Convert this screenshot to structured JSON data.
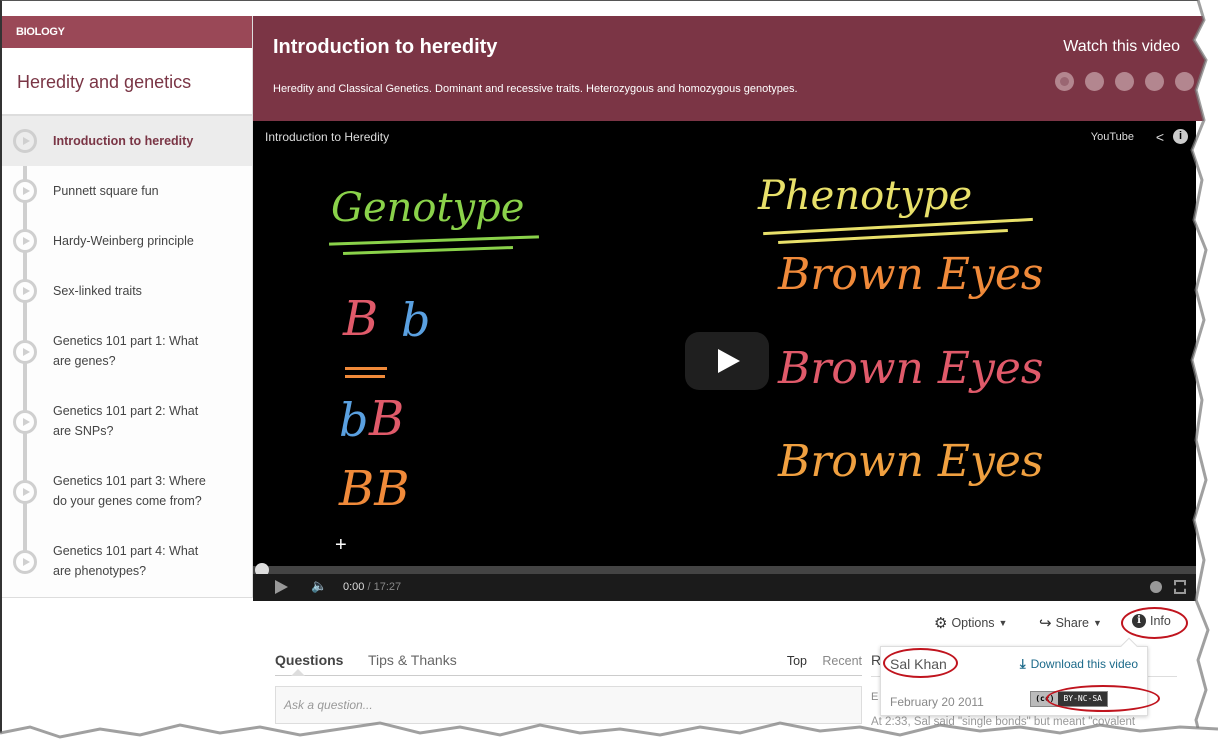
{
  "sidebar": {
    "topic": "BIOLOGY",
    "title": "Heredity and genetics",
    "items": [
      {
        "label": "Introduction to heredity",
        "active": true
      },
      {
        "label": "Punnett square fun"
      },
      {
        "label": "Hardy-Weinberg principle"
      },
      {
        "label": "Sex-linked traits"
      },
      {
        "label": "Genetics 101 part 1: What are genes?"
      },
      {
        "label": "Genetics 101 part 2: What are SNPs?"
      },
      {
        "label": "Genetics 101 part 3: Where do your genes come from?"
      },
      {
        "label": "Genetics 101 part 4: What are phenotypes?"
      }
    ]
  },
  "header": {
    "title": "Introduction to heredity",
    "description": "Heredity and Classical Genetics. Dominant and recessive traits. Heterozygous and homozygous genotypes.",
    "watch_label": "Watch this video",
    "progress_dots": 5,
    "current_dot": 1,
    "color": "#7b3545"
  },
  "video": {
    "title": "Introduction to Heredity",
    "provider": "YouTube",
    "current_time": "0:00",
    "duration": "17:27",
    "progress": 0,
    "frame_text": {
      "genotype_heading": "Genotype",
      "phenotype_heading": "Phenotype",
      "genotype_1_a": "B",
      "genotype_1_b": "b",
      "genotype_2_a": "b",
      "genotype_2_b": "B",
      "genotype_3": "BB",
      "phenotype_1": "Brown Eyes",
      "phenotype_2": "Brown Eyes",
      "phenotype_3": "Brown Eyes"
    }
  },
  "actions": {
    "options_label": "Options",
    "share_label": "Share",
    "info_label": "Info"
  },
  "info_popover": {
    "author": "Sal Khan",
    "download_label": "Download this video",
    "date": "February 20 2011",
    "license_cc": "(cc)",
    "license": "BY-NC-SA"
  },
  "discussion": {
    "tabs": [
      "Questions",
      "Tips & Thanks"
    ],
    "active_tab": "Questions",
    "sort_options": [
      "Top",
      "Recent"
    ],
    "selected_sort": "Top",
    "input_placeholder": "Ask a question...",
    "right_heading_partial": "R",
    "right_sub_partial": "E",
    "comment_preview": "At 2:33, Sal said \"single bonds\" but meant \"covalent"
  }
}
